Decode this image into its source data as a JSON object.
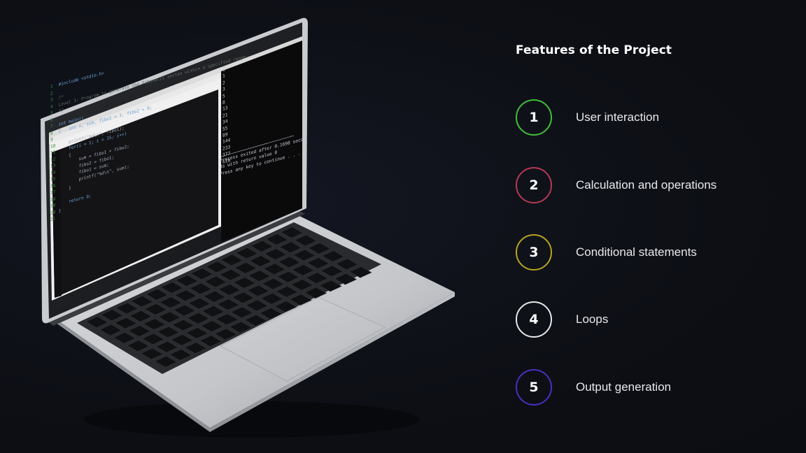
{
  "features": {
    "title": "Features of the Project",
    "items": [
      {
        "number": "1",
        "label": "User interaction",
        "color": "#3fbf3a"
      },
      {
        "number": "2",
        "label": "Calculation and operations",
        "color": "#b33a55"
      },
      {
        "number": "3",
        "label": "Conditional statements",
        "color": "#b5a51e"
      },
      {
        "number": "4",
        "label": "Loops",
        "color": "#e8e8e8"
      },
      {
        "number": "5",
        "label": "Output generation",
        "color": "#4a2fc0"
      }
    ]
  },
  "editor": {
    "code_lines": [
      {
        "n": "1",
        "text": "#include <stdio.h>"
      },
      {
        "n": "2",
        "text": ""
      },
      {
        "n": "3",
        "text": "/*"
      },
      {
        "n": "4",
        "text": "Level 1: Program to generate the Fibonacci series within a specified range."
      },
      {
        "n": "5",
        "text": "*/"
      },
      {
        "n": "6",
        "text": ""
      },
      {
        "n": "7",
        "text": "int main()"
      },
      {
        "n": "8",
        "text": "{   int i, sum, fibo1 = 1, fibo2 = 0;"
      },
      {
        "n": "9",
        "text": ""
      },
      {
        "n": "10",
        "text": "    printf(\"%d\\n\", fibo1);"
      },
      {
        "n": "11",
        "text": "    for(i = 1; i < 15; i++)"
      },
      {
        "n": "12",
        "text": "    {"
      },
      {
        "n": "13",
        "text": "        sum = fibo1 + fibo2;"
      },
      {
        "n": "14",
        "text": "        fibo2 = fibo1;"
      },
      {
        "n": "15",
        "text": "        fibo1 = sum;"
      },
      {
        "n": "16",
        "text": "        printf(\"%d\\n\", sum);"
      },
      {
        "n": "17",
        "text": "    }"
      },
      {
        "n": "18",
        "text": ""
      },
      {
        "n": "19",
        "text": "    return 0;"
      },
      {
        "n": "20",
        "text": "}"
      },
      {
        "n": "21",
        "text": ""
      }
    ]
  },
  "console": {
    "output_numbers": "1\n1\n2\n3\n5\n8\n13\n21\n34\n55\n89\n144\n233\n377\n610",
    "footer": "Process exited after 0.1698 secon\nds with return value 0\nPress any key to continue . . ."
  }
}
